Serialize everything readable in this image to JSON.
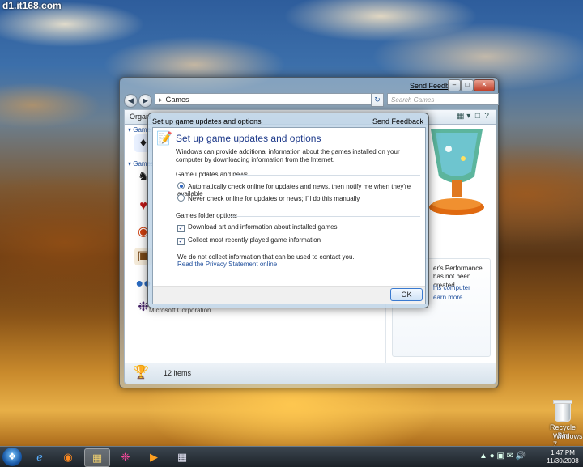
{
  "watermark": "d1.it168.com",
  "desktop": {
    "recycle_bin_label": "Recycle Bin",
    "os_label": "Windows 7"
  },
  "explorer": {
    "send_feedback": "Send Feedback",
    "address": "Games",
    "search_placeholder": "Search Games",
    "organize_label": "Organi",
    "group1_label": "Game",
    "group2_label": "Games",
    "publisher": "Microsoft Corporation",
    "performance_text_1": "er's Performance",
    "performance_text_2": "has not been created.",
    "performance_link_1": "his computer",
    "performance_link_2": "earn more",
    "status_count": "12 items"
  },
  "dialog": {
    "caption": "Set up game updates and options",
    "send_feedback": "Send Feedback",
    "title": "Set up game updates and options",
    "description": "Windows can provide additional information about the games installed on your computer by downloading information from the Internet.",
    "section_updates": "Game updates and news",
    "radio_auto": "Automatically check online for updates and news, then notify me when they're available",
    "radio_never": "Never check online for updates or news; I'll do this manually",
    "section_folder": "Games folder options",
    "check_download": "Download art and information about installed games",
    "check_collect": "Collect most recently played game information",
    "note": "We do not collect information that can be used to contact you.",
    "privacy_link": "Read the Privacy Statement online",
    "ok_label": "OK",
    "radio_auto_selected": true,
    "check_download_checked": true,
    "check_collect_checked": true
  },
  "taskbar": {
    "time": "1:47 PM",
    "date": "11/30/2008"
  },
  "icons": [
    "start-orb-icon",
    "ie-icon",
    "firefox-icon",
    "explorer-folder-icon",
    "game-app-icon",
    "media-player-icon",
    "window-list-icon"
  ]
}
